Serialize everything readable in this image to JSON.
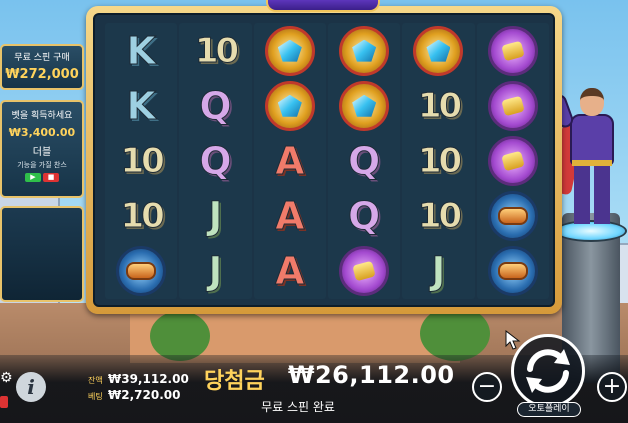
{
  "game": {
    "logo_text": ""
  },
  "left_panels": {
    "buy_free_spins": {
      "title": "무료 스핀 구매",
      "price": "₩272,000"
    },
    "double_chance": {
      "title": "벳을 획득하세요",
      "amount": "₩3,400.00",
      "label": "더블",
      "subtitle": "기능을 가질 찬스",
      "toggle_on": "▶",
      "toggle_off": "■"
    }
  },
  "reels": [
    [
      "K",
      "K",
      "10",
      "10",
      "ring"
    ],
    [
      "10",
      "Q",
      "Q",
      "J",
      "J"
    ],
    [
      "gem",
      "gem",
      "A",
      "A",
      "A"
    ],
    [
      "gem",
      "gem",
      "Q",
      "Q",
      "gauntlet"
    ],
    [
      "gem",
      "10",
      "10",
      "10",
      "J"
    ],
    [
      "gauntlet",
      "gauntlet",
      "gauntlet",
      "ring",
      "ring"
    ]
  ],
  "bottom_bar": {
    "credit_label": "잔액",
    "credit_value": "₩39,112.00",
    "bet_label": "베팅",
    "bet_value": "₩2,720.00",
    "win_label": "당첨금",
    "win_value": "₩26,112.00",
    "status_text": "무료 스핀 완료",
    "autoplay_label": "오토플레이",
    "minus_label": "−",
    "plus_label": "+",
    "info_label": "i",
    "settings_icon": "⚙"
  },
  "colors": {
    "gold": "#ffd35c",
    "frame": "#e8c36a",
    "panel": "#1b3346"
  }
}
